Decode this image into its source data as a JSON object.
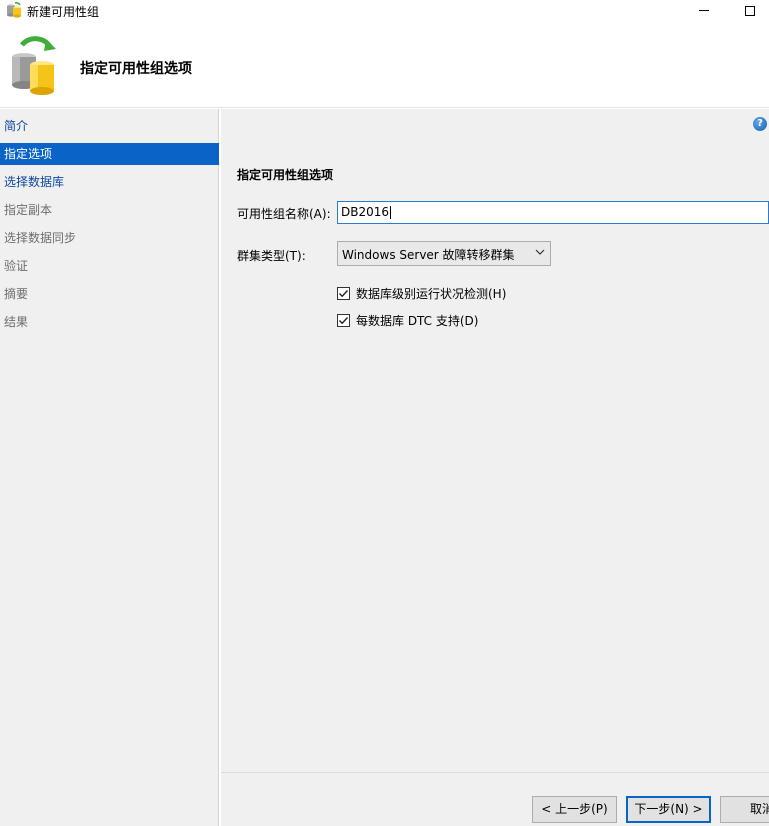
{
  "window": {
    "title": "新建可用性组",
    "minimize_icon": "minimize-icon",
    "maximize_icon": "maximize-icon"
  },
  "header": {
    "title": "指定可用性组选项",
    "icon": "database-sync-icon"
  },
  "nav": {
    "items": [
      {
        "label": "简介",
        "state": "link"
      },
      {
        "label": "指定选项",
        "state": "active"
      },
      {
        "label": "选择数据库",
        "state": "link"
      },
      {
        "label": "指定副本",
        "state": "disabled"
      },
      {
        "label": "选择数据同步",
        "state": "disabled"
      },
      {
        "label": "验证",
        "state": "disabled"
      },
      {
        "label": "摘要",
        "state": "disabled"
      },
      {
        "label": "结果",
        "state": "disabled"
      }
    ]
  },
  "main": {
    "help_icon": "help-icon",
    "section_title": "指定可用性组选项",
    "name_label": "可用性组名称(A):",
    "name_value": "DB2016",
    "cluster_label": "群集类型(T):",
    "cluster_value": "Windows Server 故障转移群集",
    "checkbox_health": {
      "label": "数据库级别运行状况检测(H)",
      "checked": true
    },
    "checkbox_dtc": {
      "label": "每数据库 DTC 支持(D)",
      "checked": true
    }
  },
  "footer": {
    "back_label": "< 上一步(P)",
    "next_label": "下一步(N) >",
    "cancel_label": "取消"
  },
  "colors": {
    "active_nav": "#0a64c8",
    "link_nav": "#0d47a1",
    "disabled_nav": "#6d6d6d",
    "panel_bg": "#f0f0f0"
  }
}
